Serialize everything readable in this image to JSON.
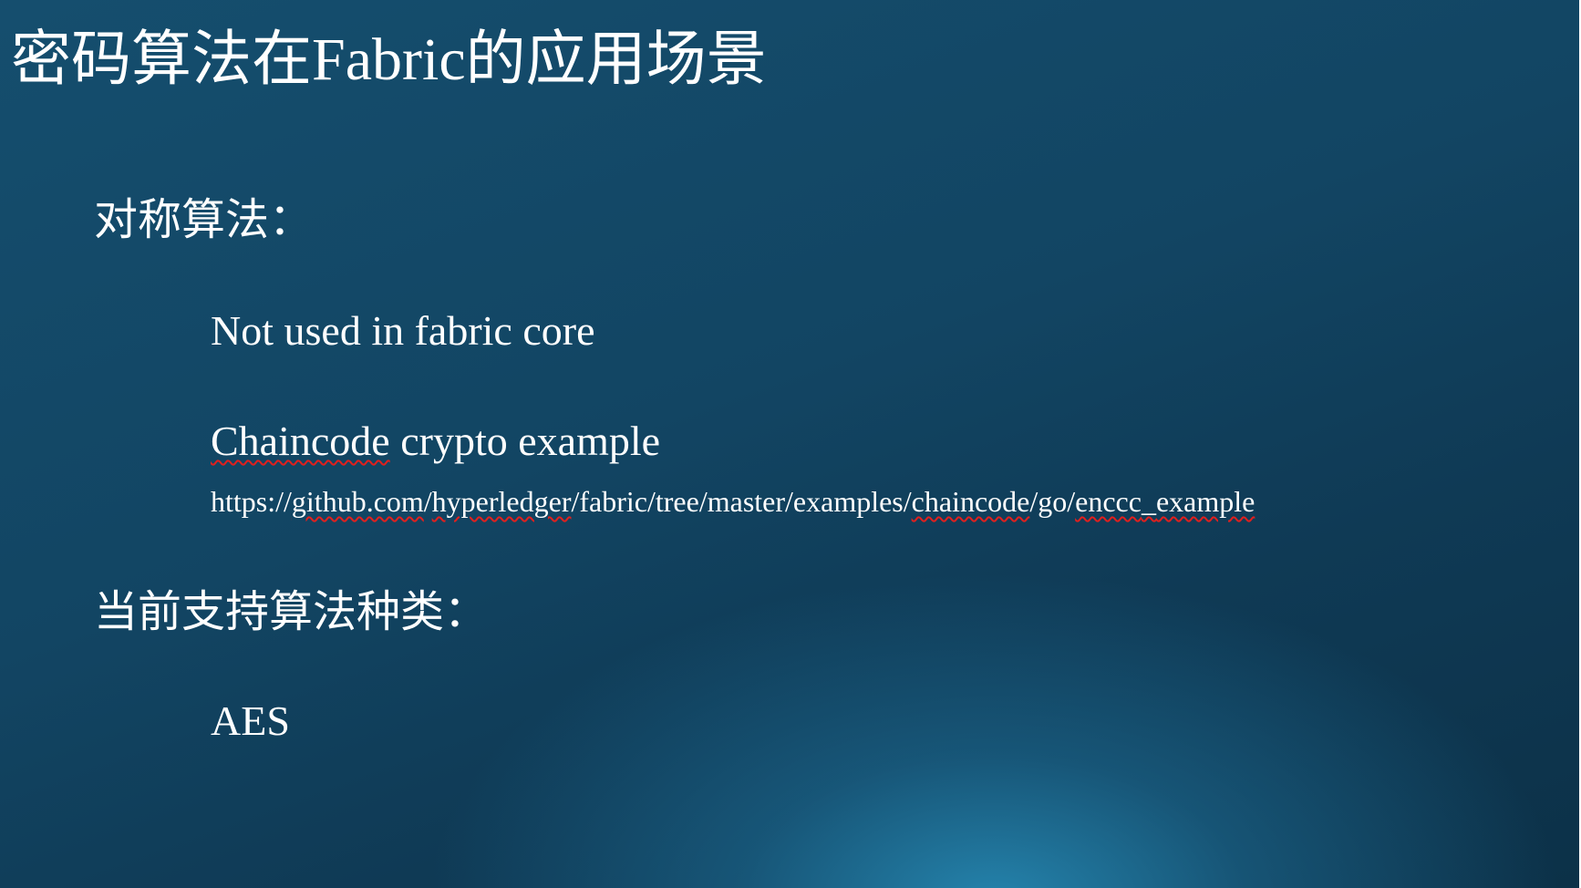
{
  "slide": {
    "title": "密码算法在Fabric的应用场景",
    "sections": [
      {
        "heading": "对称算法：",
        "items": [
          "Not used in fabric core",
          "Chaincode crypto example"
        ],
        "link": {
          "prefix": "https://",
          "host": "github.com",
          "sep1": "/",
          "org": "hyperledger",
          "middle": "/fabric/tree/master/examples/",
          "dir": "chaincode",
          "sep2": "/go/",
          "example_part1": "enccc",
          "underscore": "_",
          "example_part2": "example"
        }
      },
      {
        "heading": "当前支持算法种类：",
        "items": [
          "AES"
        ]
      }
    ],
    "item_2_parts": {
      "word": "Chaincode",
      "rest": " crypto example"
    }
  },
  "colors": {
    "background_dark": "#0f3a55",
    "background_light": "#2688b2",
    "text": "#ffffff",
    "spellcheck_underline": "#e0201e"
  }
}
